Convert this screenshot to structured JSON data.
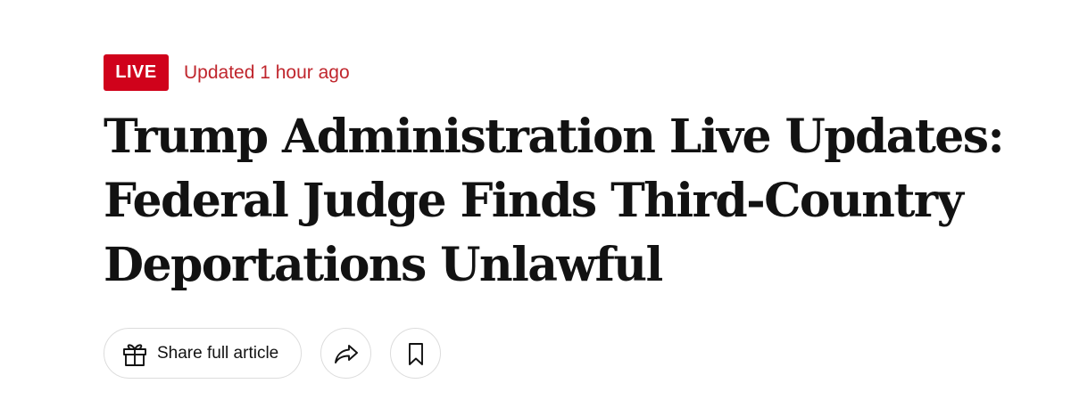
{
  "badge": {
    "label": "LIVE",
    "color": "#d0021b"
  },
  "updated": {
    "text": "Updated 1 hour ago",
    "color": "#c0262d"
  },
  "headline": "Trump Administration Live Updates: Federal Judge Finds Third-Country Deportations Unlawful",
  "actions": {
    "share_full_article_label": "Share full article",
    "share_full_article_icon": "gift-icon",
    "share_icon": "share-arrow-icon",
    "save_icon": "bookmark-icon"
  }
}
